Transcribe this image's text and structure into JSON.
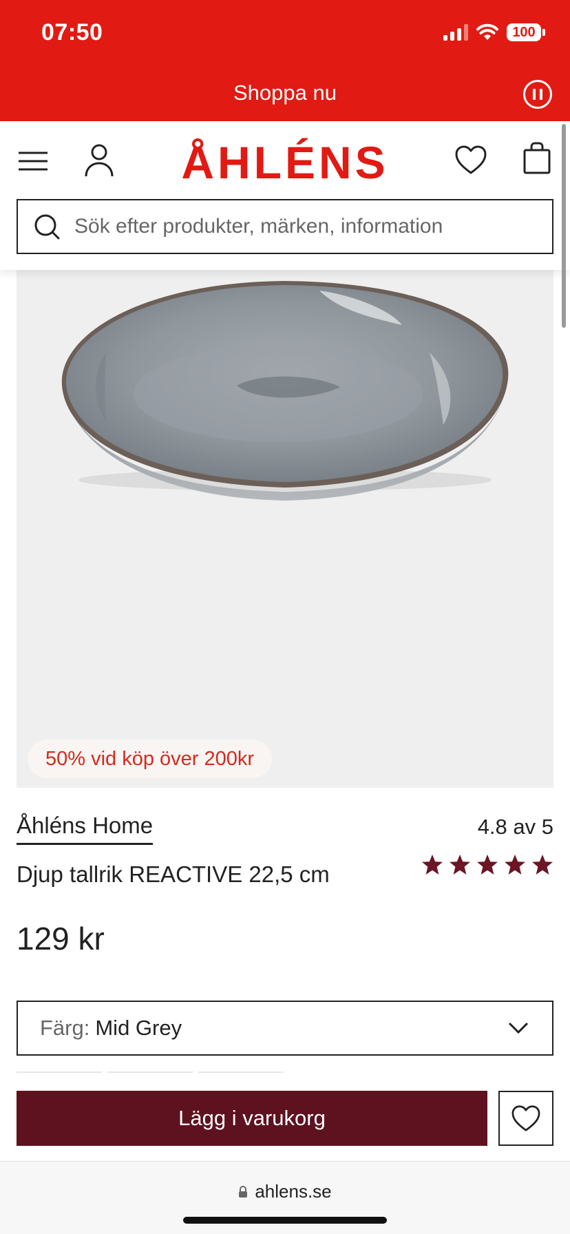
{
  "status_bar": {
    "time": "07:50",
    "battery": "100"
  },
  "banner": {
    "text": "Shoppa nu"
  },
  "header": {
    "logo": "ÅHLÉNS",
    "search_placeholder": "Sök efter produkter, märken, information"
  },
  "product": {
    "promo_badge": "50% vid köp över 200kr",
    "brand": "Åhléns Home",
    "rating_text": "4.8 av 5",
    "rating_value": 4.8,
    "rating_max": 5,
    "title": "Djup tallrik REACTIVE 22,5 cm",
    "price": "129 kr",
    "color_label": "Färg:",
    "color_value": "Mid Grey",
    "add_to_cart": "Lägg i varukorg"
  },
  "browser": {
    "url": "ahlens.se"
  },
  "colors": {
    "brand_red": "#e11b13",
    "cta_dark_red": "#5e1220",
    "star": "#6b1525"
  }
}
